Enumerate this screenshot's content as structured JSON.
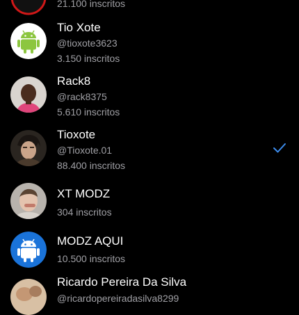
{
  "accounts": [
    {
      "name": "",
      "handle": "",
      "subscribers": "21.100 inscritos",
      "avatar_icon": "red-ring-avatar-icon",
      "selected": false
    },
    {
      "name": "Tio Xote",
      "handle": "@tioxote3623",
      "subscribers": "3.150 inscritos",
      "avatar_icon": "android-icon",
      "selected": false
    },
    {
      "name": "Rack8",
      "handle": "@rack8375",
      "subscribers": "5.610 inscritos",
      "avatar_icon": "person-photo-icon",
      "selected": false
    },
    {
      "name": "Tioxote",
      "handle": "@Tioxote.01",
      "subscribers": "88.400 inscritos",
      "avatar_icon": "anime-character-icon",
      "selected": true
    },
    {
      "name": "XT MODZ",
      "handle": "",
      "subscribers": "304 inscritos",
      "avatar_icon": "person-photo-icon",
      "selected": false
    },
    {
      "name": "MODZ AQUI",
      "handle": "",
      "subscribers": "10.500 inscritos",
      "avatar_icon": "android-icon",
      "selected": false
    },
    {
      "name": "Ricardo Pereira Da Silva",
      "handle": "@ricardopereiradasilva8299",
      "subscribers": "",
      "avatar_icon": "person-photo-icon",
      "selected": false
    }
  ],
  "colors": {
    "background": "#000000",
    "secondary_text": "#a0a0a5",
    "check_color": "#3d8ef0",
    "android_green_bg": "#ffffff",
    "android_green": "#8cc63f",
    "android_blue_bg": "#1a73d9"
  },
  "icons": {
    "checkmark": "checkmark-icon"
  }
}
